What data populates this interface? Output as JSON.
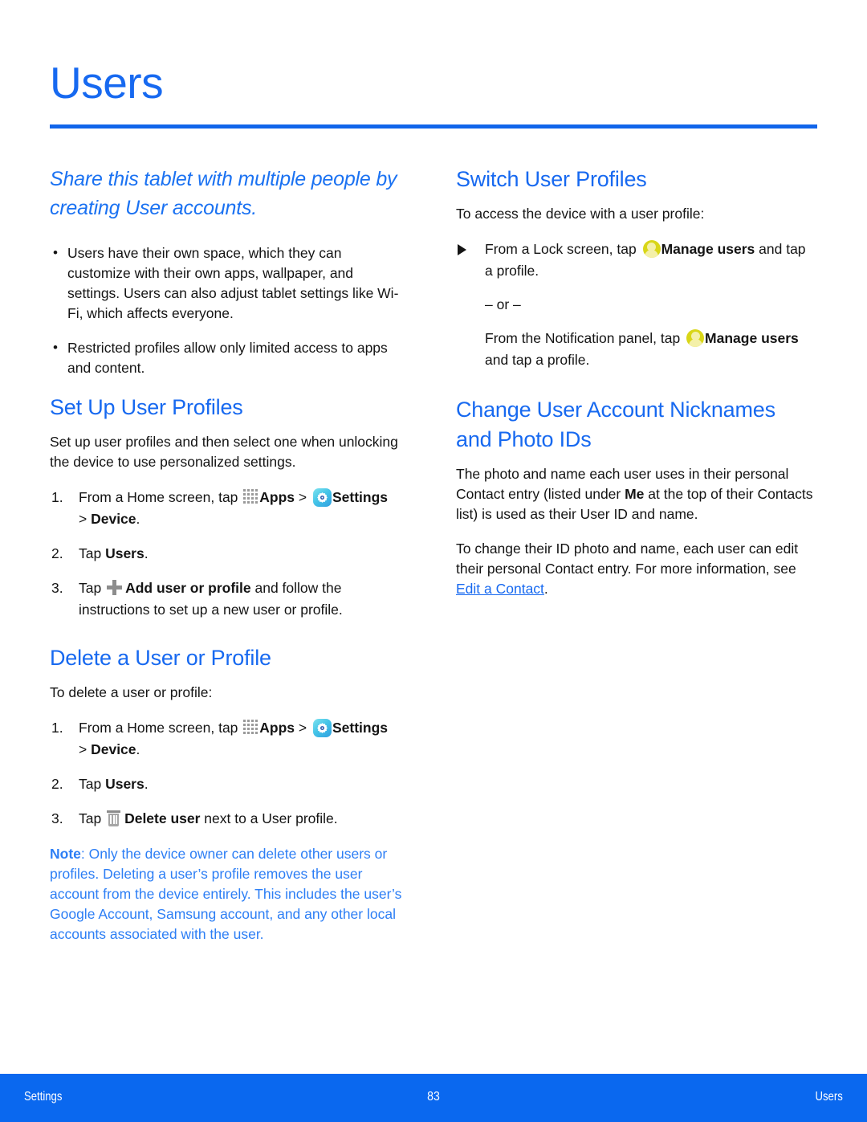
{
  "header": {
    "title": "Users",
    "rule_color": "#1165ea"
  },
  "theme": {
    "accent_blue": "#1769f0",
    "note_blue": "#2c7ef5",
    "footer_blue": "#0a68ef",
    "body_black": "#141414"
  },
  "left_column": {
    "lede": "Share this tablet with multiple people by creating User accounts.",
    "bullets": [
      "Users have their own space, which they can customize with their own apps, wallpaper, and settings. Users can also adjust tablet settings like Wi-Fi, which affects everyone.",
      "Restricted profiles allow only limited access to apps and content."
    ],
    "set_up": {
      "heading": "Set Up User Profiles",
      "intro": "Set up user profiles and then select one when unlocking the device to use personalized settings.",
      "step1_pre": "From a Home screen, tap ",
      "step1_apps": "Apps",
      "step1_sep": " > ",
      "step1_settings": "Settings",
      "step1_post_bold": "Device",
      "step1_tail": ".",
      "step1_gt": "> ",
      "step2_pre": "Tap ",
      "step2_bold": "Users",
      "step2_tail": ".",
      "step3_pre": "Tap ",
      "step3_bold": "Add user or profile",
      "step3_post": " and follow the instructions to set up a new user or profile."
    },
    "delete": {
      "heading": "Delete a User or Profile",
      "intro": "To delete a user or profile:",
      "step1_pre": "From a Home screen, tap ",
      "step1_apps": "Apps",
      "step1_sep": " > ",
      "step1_settings": "Settings",
      "step1_gt": "> ",
      "step1_post_bold": "Device",
      "step1_tail": ".",
      "step2_pre": "Tap ",
      "step2_bold": "Users",
      "step2_tail": ".",
      "step3_pre": "Tap ",
      "step3_bold": "Delete user",
      "step3_post": " next to a User profile."
    },
    "note": {
      "label": "Note",
      "text": ": Only the device owner can delete other users or profiles. Deleting a user’s profile removes the user account from the device entirely. This includes the user’s Google Account, Samsung account, and any other local accounts associated with the user."
    }
  },
  "right_column": {
    "switch": {
      "heading": "Switch User Profiles",
      "intro": "To access the device with a user profile:",
      "item_pre": "From a Lock screen, tap ",
      "item_bold": "Manage users",
      "item_post": " and tap a profile.",
      "or": "– or –",
      "alt_pre": "From the Notification panel, tap ",
      "alt_bold": "Manage users",
      "alt_post": " and tap a profile."
    },
    "change": {
      "heading": "Change User Account Nicknames and Photo IDs",
      "para1_a": "The photo and name each user uses in their personal Contact entry (listed under ",
      "para1_bold": "Me",
      "para1_b": " at the top of their Contacts list) is used as their User ID and name.",
      "para2_a": "To change their ID photo and name, each user can edit their personal Contact entry. For more information, see ",
      "para2_link": "Edit a Contact",
      "para2_b": "."
    }
  },
  "footer": {
    "left": "Settings",
    "page_number": "83",
    "right": "Users"
  },
  "icons": {
    "apps": "apps-grid-icon",
    "settings": "settings-gear-icon",
    "plus": "plus-icon",
    "trash": "trash-icon",
    "manage_users": "manage-users-icon"
  }
}
